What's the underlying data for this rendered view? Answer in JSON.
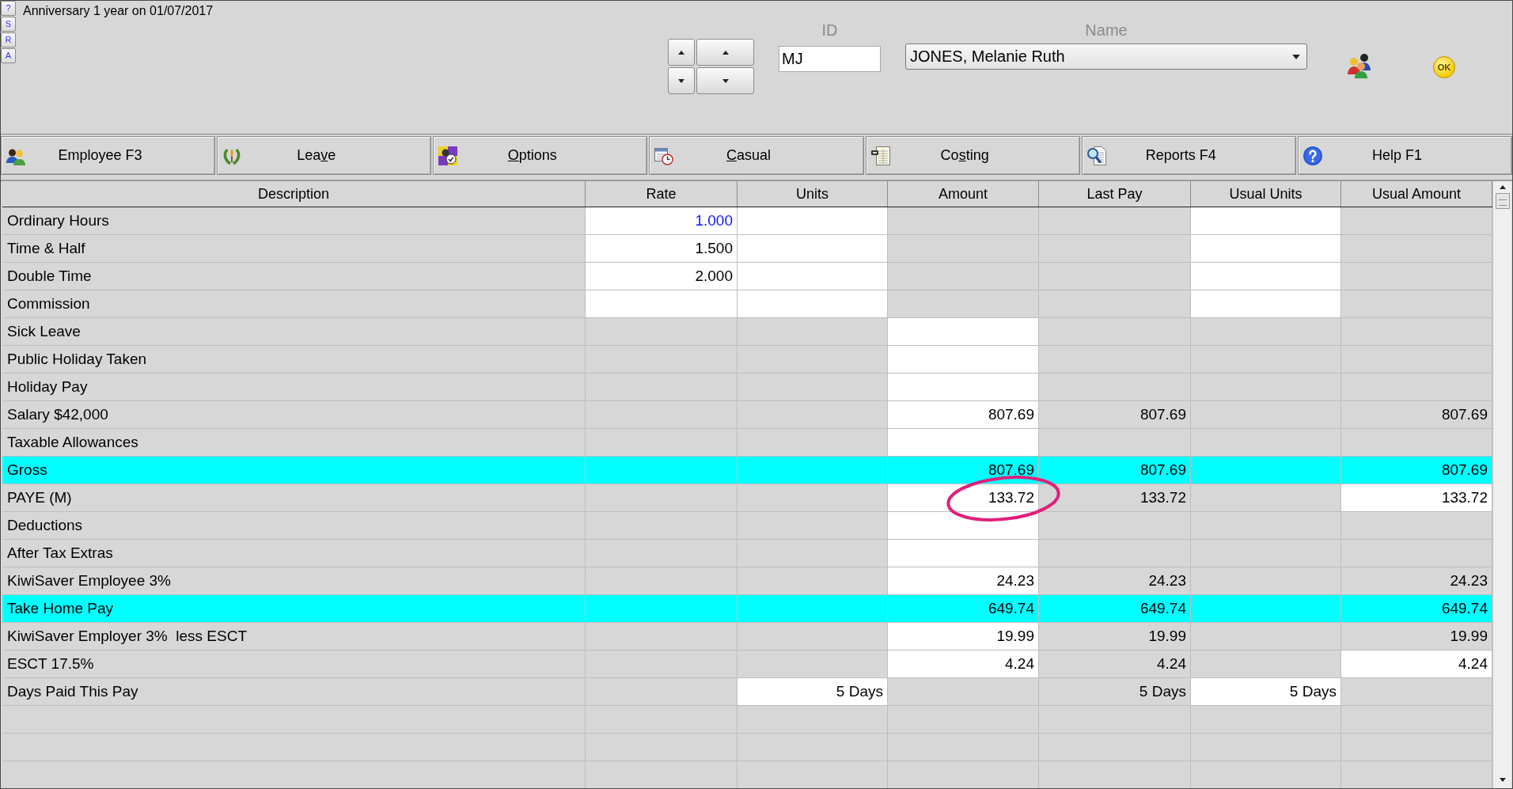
{
  "side_buttons": [
    "?",
    "S",
    "R",
    "A"
  ],
  "notice": "Anniversary 1 year on 01/07/2017",
  "employee": {
    "id_label": "ID",
    "id": "MJ",
    "name_label": "Name",
    "name": "JONES, Melanie Ruth"
  },
  "ok_button": "OK",
  "tabs": [
    {
      "label_parts": [
        {
          "text": "Employee F3",
          "underlined": false
        }
      ]
    },
    {
      "label_parts": [
        {
          "text": "Lea",
          "underlined": false
        },
        {
          "text": "v",
          "underlined": true
        },
        {
          "text": "e",
          "underlined": false
        }
      ]
    },
    {
      "label_parts": [
        {
          "text": "O",
          "underlined": true
        },
        {
          "text": "ptions",
          "underlined": false
        }
      ]
    },
    {
      "label_parts": [
        {
          "text": "C",
          "underlined": true
        },
        {
          "text": "asual",
          "underlined": false
        }
      ]
    },
    {
      "label_parts": [
        {
          "text": "Co",
          "underlined": false
        },
        {
          "text": "s",
          "underlined": true
        },
        {
          "text": "ting",
          "underlined": false
        }
      ]
    },
    {
      "label_parts": [
        {
          "text": "Reports F4",
          "underlined": false
        }
      ]
    },
    {
      "label_parts": [
        {
          "text": "Help F1",
          "underlined": false
        }
      ]
    }
  ],
  "table": {
    "columns": [
      "Description",
      "Rate",
      "Units",
      "Amount",
      "Last Pay",
      "Usual Units",
      "Usual Amount"
    ],
    "rows": [
      {
        "description": "Ordinary Hours",
        "total": false,
        "cells": [
          {
            "text": "1.000",
            "editable": true,
            "focused": true,
            "circled": false
          },
          {
            "editable": true,
            "focused": false,
            "circled": false
          },
          {
            "editable": false,
            "focused": false,
            "circled": false
          },
          {
            "editable": false,
            "focused": false,
            "circled": false
          },
          {
            "editable": true,
            "focused": false,
            "circled": false
          },
          {
            "editable": false,
            "focused": false,
            "circled": false
          }
        ]
      },
      {
        "description": "Time & Half",
        "total": false,
        "cells": [
          {
            "text": "1.500",
            "editable": true,
            "focused": false,
            "circled": false
          },
          {
            "editable": true,
            "focused": false,
            "circled": false
          },
          {
            "editable": false,
            "focused": false,
            "circled": false
          },
          {
            "editable": false,
            "focused": false,
            "circled": false
          },
          {
            "editable": true,
            "focused": false,
            "circled": false
          },
          {
            "editable": false,
            "focused": false,
            "circled": false
          }
        ]
      },
      {
        "description": "Double Time",
        "total": false,
        "cells": [
          {
            "text": "2.000",
            "editable": true,
            "focused": false,
            "circled": false
          },
          {
            "editable": true,
            "focused": false,
            "circled": false
          },
          {
            "editable": false,
            "focused": false,
            "circled": false
          },
          {
            "editable": false,
            "focused": false,
            "circled": false
          },
          {
            "editable": true,
            "focused": false,
            "circled": false
          },
          {
            "editable": false,
            "focused": false,
            "circled": false
          }
        ]
      },
      {
        "description": "Commission",
        "total": false,
        "cells": [
          {
            "editable": true,
            "focused": false,
            "circled": false
          },
          {
            "editable": true,
            "focused": false,
            "circled": false
          },
          {
            "editable": false,
            "focused": false,
            "circled": false
          },
          {
            "editable": false,
            "focused": false,
            "circled": false
          },
          {
            "editable": true,
            "focused": false,
            "circled": false
          },
          {
            "editable": false,
            "focused": false,
            "circled": false
          }
        ]
      },
      {
        "description": "Sick Leave",
        "total": false,
        "cells": [
          {
            "editable": false,
            "focused": false,
            "circled": false
          },
          {
            "editable": false,
            "focused": false,
            "circled": false
          },
          {
            "editable": true,
            "focused": false,
            "circled": false
          },
          {
            "editable": false,
            "focused": false,
            "circled": false
          },
          {
            "editable": false,
            "focused": false,
            "circled": false
          },
          {
            "editable": false,
            "focused": false,
            "circled": false
          }
        ]
      },
      {
        "description": "Public Holiday Taken",
        "total": false,
        "cells": [
          {
            "editable": false,
            "focused": false,
            "circled": false
          },
          {
            "editable": false,
            "focused": false,
            "circled": false
          },
          {
            "editable": true,
            "focused": false,
            "circled": false
          },
          {
            "editable": false,
            "focused": false,
            "circled": false
          },
          {
            "editable": false,
            "focused": false,
            "circled": false
          },
          {
            "editable": false,
            "focused": false,
            "circled": false
          }
        ]
      },
      {
        "description": "Holiday Pay",
        "total": false,
        "cells": [
          {
            "editable": false,
            "focused": false,
            "circled": false
          },
          {
            "editable": false,
            "focused": false,
            "circled": false
          },
          {
            "editable": true,
            "focused": false,
            "circled": false
          },
          {
            "editable": false,
            "focused": false,
            "circled": false
          },
          {
            "editable": false,
            "focused": false,
            "circled": false
          },
          {
            "editable": false,
            "focused": false,
            "circled": false
          }
        ]
      },
      {
        "description": "Salary $42,000",
        "total": false,
        "cells": [
          {
            "editable": false,
            "focused": false,
            "circled": false
          },
          {
            "editable": false,
            "focused": false,
            "circled": false
          },
          {
            "text": "807.69",
            "editable": true,
            "focused": false,
            "circled": false
          },
          {
            "text": "807.69",
            "editable": false,
            "focused": false,
            "circled": false
          },
          {
            "editable": false,
            "focused": false,
            "circled": false
          },
          {
            "text": "807.69",
            "editable": false,
            "focused": false,
            "circled": false
          }
        ]
      },
      {
        "description": "Taxable Allowances",
        "total": false,
        "cells": [
          {
            "editable": false,
            "focused": false,
            "circled": false
          },
          {
            "editable": false,
            "focused": false,
            "circled": false
          },
          {
            "editable": true,
            "focused": false,
            "circled": false
          },
          {
            "editable": false,
            "focused": false,
            "circled": false
          },
          {
            "editable": false,
            "focused": false,
            "circled": false
          },
          {
            "editable": false,
            "focused": false,
            "circled": false
          }
        ]
      },
      {
        "description": "Gross",
        "total": true,
        "cells": [
          {
            "editable": false,
            "focused": false,
            "circled": false
          },
          {
            "editable": false,
            "focused": false,
            "circled": false
          },
          {
            "text": "807.69",
            "editable": false,
            "focused": false,
            "circled": false
          },
          {
            "text": "807.69",
            "editable": false,
            "focused": false,
            "circled": false
          },
          {
            "editable": false,
            "focused": false,
            "circled": false
          },
          {
            "text": "807.69",
            "editable": false,
            "focused": false,
            "circled": false
          }
        ]
      },
      {
        "description": "PAYE (M)",
        "total": false,
        "cells": [
          {
            "editable": false,
            "focused": false,
            "circled": false
          },
          {
            "editable": false,
            "focused": false,
            "circled": false
          },
          {
            "text": "133.72",
            "editable": true,
            "focused": false,
            "circled": true
          },
          {
            "text": "133.72",
            "editable": false,
            "focused": false,
            "circled": false
          },
          {
            "editable": false,
            "focused": false,
            "circled": false
          },
          {
            "text": "133.72",
            "editable": true,
            "focused": false,
            "circled": false
          }
        ]
      },
      {
        "description": "Deductions",
        "total": false,
        "cells": [
          {
            "editable": false,
            "focused": false,
            "circled": false
          },
          {
            "editable": false,
            "focused": false,
            "circled": false
          },
          {
            "editable": true,
            "focused": false,
            "circled": false
          },
          {
            "editable": false,
            "focused": false,
            "circled": false
          },
          {
            "editable": false,
            "focused": false,
            "circled": false
          },
          {
            "editable": false,
            "focused": false,
            "circled": false
          }
        ]
      },
      {
        "description": "After Tax Extras",
        "total": false,
        "cells": [
          {
            "editable": false,
            "focused": false,
            "circled": false
          },
          {
            "editable": false,
            "focused": false,
            "circled": false
          },
          {
            "editable": true,
            "focused": false,
            "circled": false
          },
          {
            "editable": false,
            "focused": false,
            "circled": false
          },
          {
            "editable": false,
            "focused": false,
            "circled": false
          },
          {
            "editable": false,
            "focused": false,
            "circled": false
          }
        ]
      },
      {
        "description": "KiwiSaver Employee 3%",
        "total": false,
        "cells": [
          {
            "editable": false,
            "focused": false,
            "circled": false
          },
          {
            "editable": false,
            "focused": false,
            "circled": false
          },
          {
            "text": "24.23",
            "editable": true,
            "focused": false,
            "circled": false
          },
          {
            "text": "24.23",
            "editable": false,
            "focused": false,
            "circled": false
          },
          {
            "editable": false,
            "focused": false,
            "circled": false
          },
          {
            "text": "24.23",
            "editable": false,
            "focused": false,
            "circled": false
          }
        ]
      },
      {
        "description": "Take Home Pay",
        "total": true,
        "cells": [
          {
            "editable": false,
            "focused": false,
            "circled": false
          },
          {
            "editable": false,
            "focused": false,
            "circled": false
          },
          {
            "text": "649.74",
            "editable": false,
            "focused": false,
            "circled": false
          },
          {
            "text": "649.74",
            "editable": false,
            "focused": false,
            "circled": false
          },
          {
            "editable": false,
            "focused": false,
            "circled": false
          },
          {
            "text": "649.74",
            "editable": false,
            "focused": false,
            "circled": false
          }
        ]
      },
      {
        "description": "KiwiSaver Employer 3%  less ESCT",
        "total": false,
        "cells": [
          {
            "editable": false,
            "focused": false,
            "circled": false
          },
          {
            "editable": false,
            "focused": false,
            "circled": false
          },
          {
            "text": "19.99",
            "editable": true,
            "focused": false,
            "circled": false
          },
          {
            "text": "19.99",
            "editable": false,
            "focused": false,
            "circled": false
          },
          {
            "editable": false,
            "focused": false,
            "circled": false
          },
          {
            "text": "19.99",
            "editable": false,
            "focused": false,
            "circled": false
          }
        ]
      },
      {
        "description": "ESCT 17.5%",
        "total": false,
        "cells": [
          {
            "editable": false,
            "focused": false,
            "circled": false
          },
          {
            "editable": false,
            "focused": false,
            "circled": false
          },
          {
            "text": "4.24",
            "editable": true,
            "focused": false,
            "circled": false
          },
          {
            "text": "4.24",
            "editable": false,
            "focused": false,
            "circled": false
          },
          {
            "editable": false,
            "focused": false,
            "circled": false
          },
          {
            "text": "4.24",
            "editable": true,
            "focused": false,
            "circled": false
          }
        ]
      },
      {
        "description": "Days Paid This Pay",
        "total": false,
        "cells": [
          {
            "editable": false,
            "focused": false,
            "circled": false
          },
          {
            "text": "5 Days",
            "editable": true,
            "focused": false,
            "circled": false
          },
          {
            "editable": false,
            "focused": false,
            "circled": false
          },
          {
            "text": "5 Days",
            "editable": false,
            "focused": false,
            "circled": false
          },
          {
            "text": "5 Days",
            "editable": true,
            "focused": false,
            "circled": false
          },
          {
            "editable": false,
            "focused": false,
            "circled": false
          }
        ]
      }
    ]
  }
}
